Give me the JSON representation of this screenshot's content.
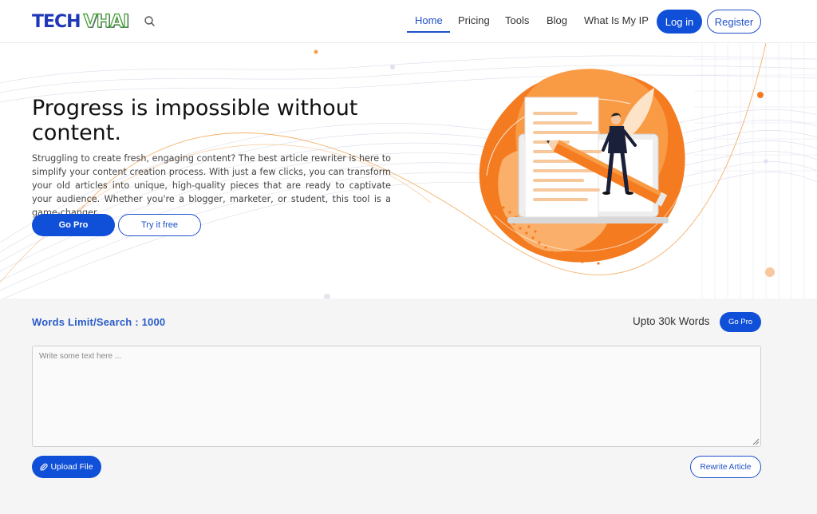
{
  "header": {
    "logo": {
      "part1": "TECH",
      "part2": "VHAI"
    },
    "nav": [
      {
        "label": "Home",
        "active": true
      },
      {
        "label": "Pricing",
        "active": false
      },
      {
        "label": "Tools",
        "active": false
      },
      {
        "label": "Blog",
        "active": false
      },
      {
        "label": "What Is My IP",
        "active": false
      }
    ],
    "login_label": "Log in",
    "register_label": "Register"
  },
  "hero": {
    "title": "Progress is impossible without content.",
    "text": "Struggling to create fresh, engaging content? The best article rewriter is here to simplify your content creation process. With just a few clicks, you can transform your old articles into unique, high-quality pieces that are ready to captivate your audience. Whether you're a blogger, marketer, or student, this tool is a game-changer.",
    "go_pro_label": "Go Pro",
    "try_free_label": "Try it free"
  },
  "tool": {
    "words_limit": "Words Limit/Search : 1000",
    "upto_text": "Upto 30k Words",
    "go_pro_label": "Go Pro",
    "textarea_placeholder": "Write some text here ...",
    "upload_label": "Upload File",
    "rewrite_label": "Rewrite Article"
  },
  "colors": {
    "primary": "#1050d8",
    "accent_orange": "#f47b20",
    "background_gray": "#f5f5f5"
  },
  "icons": [
    "search-icon",
    "paperclip-icon",
    "resize-grip-icon"
  ]
}
